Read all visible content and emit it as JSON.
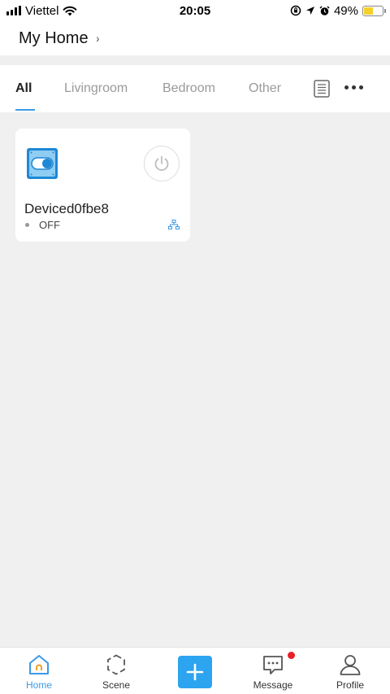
{
  "status_bar": {
    "carrier": "Viettel",
    "time": "20:05",
    "battery": "49%",
    "battery_level": 0.49,
    "icons": [
      "signal-icon",
      "wifi-icon",
      "orientation-lock-icon",
      "location-icon",
      "alarm-icon",
      "battery-icon"
    ]
  },
  "header": {
    "title": "My Home",
    "chevron": "›"
  },
  "tabs": [
    {
      "label": "All",
      "active": true
    },
    {
      "label": "Livingroom",
      "active": false
    },
    {
      "label": "Bedroom",
      "active": false
    },
    {
      "label": "Other",
      "active": false
    }
  ],
  "tab_actions": [
    "list-icon",
    "more-icon"
  ],
  "devices": [
    {
      "name": "Deviced0fbe8",
      "status": "OFF",
      "icon": "switch-device-icon",
      "connection_icon": "network-icon"
    }
  ],
  "bottom_nav": {
    "items": [
      {
        "label": "Home",
        "icon": "home-icon",
        "active": true
      },
      {
        "label": "Scene",
        "icon": "scene-icon",
        "active": false
      },
      {
        "label": "Message",
        "icon": "message-icon",
        "active": false,
        "badge": true
      },
      {
        "label": "Profile",
        "icon": "profile-icon",
        "active": false
      }
    ],
    "add_icon": "plus-icon"
  },
  "colors": {
    "accent": "#2da4ef",
    "tab_underline": "#3a9ae8",
    "background": "#f0f0f0",
    "badge": "#e8202a",
    "battery_fill": "#f5d02a"
  }
}
